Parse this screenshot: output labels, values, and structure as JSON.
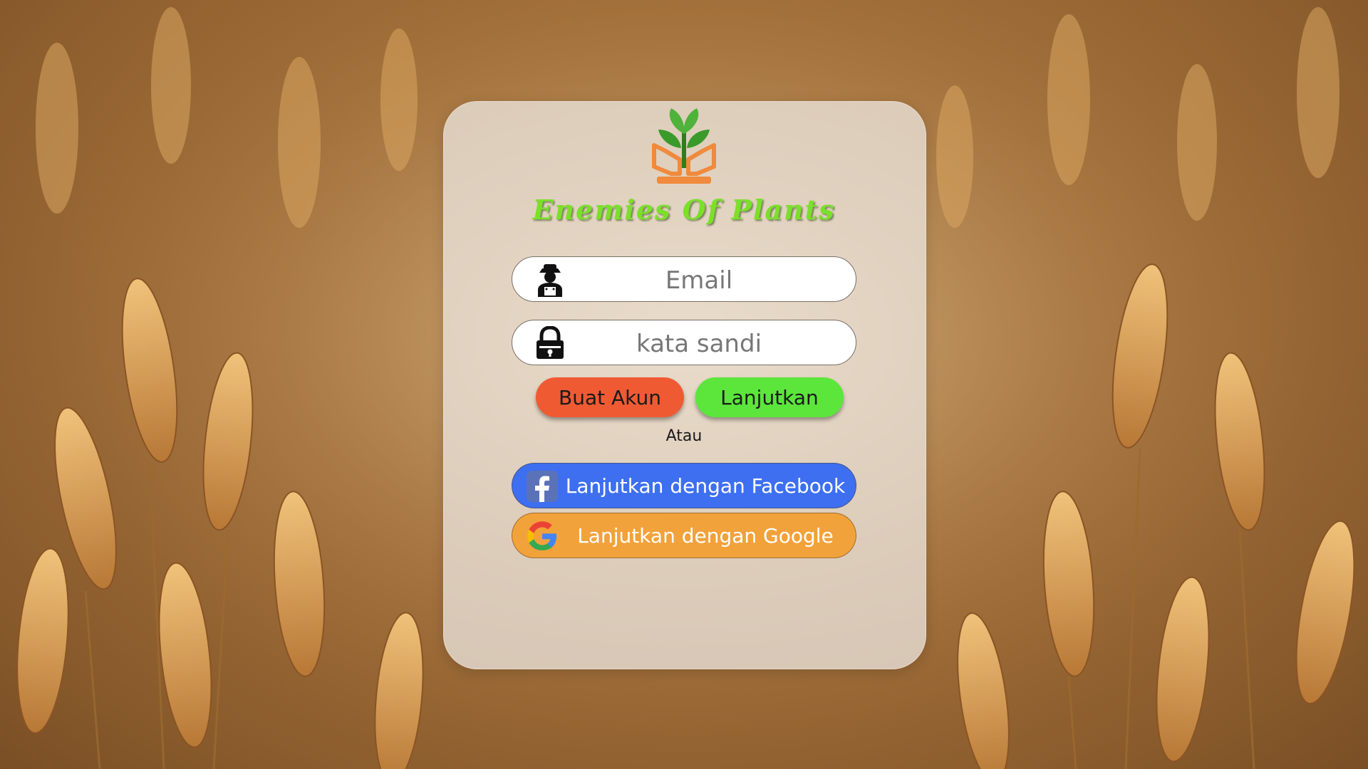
{
  "app": {
    "title": "Enemies Of Plants"
  },
  "login": {
    "email_placeholder": "Email",
    "password_placeholder": "kata sandi"
  },
  "buttons": {
    "create_account": "Buat Akun",
    "continue": "Lanjutkan"
  },
  "divider_text": "Atau",
  "social": {
    "facebook": "Lanjutkan dengan Facebook",
    "google": "Lanjutkan dengan Google"
  },
  "icons": {
    "logo": "plant-hands-logo-icon",
    "email": "farmer-user-icon",
    "password": "padlock-icon",
    "facebook": "facebook-icon",
    "google": "google-icon"
  },
  "colors": {
    "brand_green": "#7be02a",
    "create_button": "#f05a33",
    "continue_button": "#5ce63c",
    "facebook_button": "#3d6ff0",
    "google_button": "#f2a23a"
  }
}
